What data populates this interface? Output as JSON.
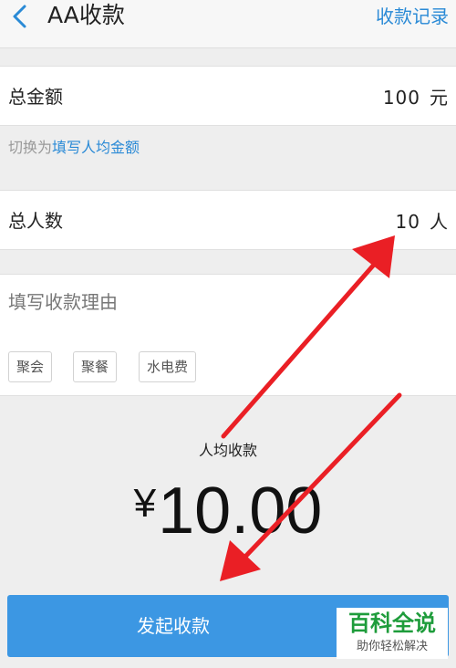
{
  "header": {
    "title": "AA收款",
    "records_label": "收款记录"
  },
  "total_amount": {
    "label": "总金额",
    "value": "100",
    "unit": "元"
  },
  "switch_mode": {
    "prefix": "切换为",
    "link": "填写人均金额"
  },
  "total_people": {
    "label": "总人数",
    "value": "10",
    "unit": "人"
  },
  "reason": {
    "placeholder": "填写收款理由",
    "tags": [
      "聚会",
      "聚餐",
      "水电费"
    ]
  },
  "per_person": {
    "label": "人均收款",
    "currency": "¥",
    "amount": "10.00"
  },
  "submit_label": "发起收款",
  "watermark": {
    "main": "百科全说",
    "sub": "助你轻松解决"
  },
  "colors": {
    "accent": "#2a8ad6",
    "button": "#3c97e3",
    "arrow": "#ea1f25",
    "watermark": "#1e9c3b"
  }
}
